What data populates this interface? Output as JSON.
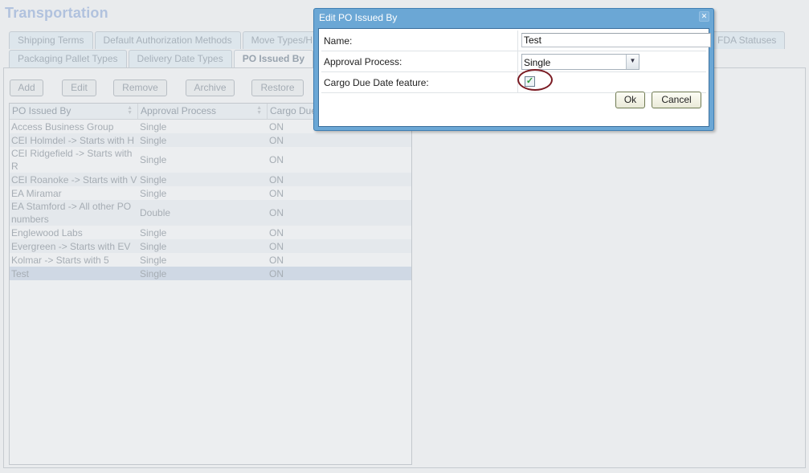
{
  "app": {
    "title": "Transportation"
  },
  "tabs": {
    "row1": [
      {
        "label": "Shipping Terms"
      },
      {
        "label": "Default Authorization Methods"
      },
      {
        "label": "Move Types/H"
      }
    ],
    "row1_right": {
      "label": "FDA Statuses"
    },
    "row2": [
      {
        "label": "Packaging Pallet Types"
      },
      {
        "label": "Delivery Date Types"
      },
      {
        "label": "PO Issued By",
        "active": true
      }
    ]
  },
  "toolbar": {
    "add_label": "Add",
    "edit_label": "Edit",
    "remove_label": "Remove",
    "archive_label": "Archive",
    "restore_label": "Restore"
  },
  "grid": {
    "columns": [
      "PO Issued By",
      "Approval Process",
      "Cargo Due"
    ],
    "rows": [
      {
        "name": "Access Business Group",
        "approval": "Single",
        "cargo": "ON"
      },
      {
        "name": "CEI Holmdel -> Starts with H",
        "approval": "Single",
        "cargo": "ON"
      },
      {
        "name": "CEI Ridgefield -> Starts with R",
        "approval": "Single",
        "cargo": "ON"
      },
      {
        "name": "CEI Roanoke -> Starts with V",
        "approval": "Single",
        "cargo": "ON"
      },
      {
        "name": "EA Miramar",
        "approval": "Single",
        "cargo": "ON"
      },
      {
        "name": "EA Stamford -> All other PO numbers",
        "approval": "Double",
        "cargo": "ON"
      },
      {
        "name": "Englewood Labs",
        "approval": "Single",
        "cargo": "ON"
      },
      {
        "name": "Evergreen -> Starts with EV",
        "approval": "Single",
        "cargo": "ON"
      },
      {
        "name": "Kolmar -> Starts with 5",
        "approval": "Single",
        "cargo": "ON"
      },
      {
        "name": "Test",
        "approval": "Single",
        "cargo": "ON",
        "selected": true
      }
    ]
  },
  "dialog": {
    "title": "Edit PO Issued By",
    "close_icon": "close-icon",
    "fields": {
      "name_label": "Name:",
      "name_value": "Test",
      "approval_label": "Approval Process:",
      "approval_value": "Single",
      "cargo_label": "Cargo Due Date feature:",
      "cargo_checked": true
    },
    "ok_label": "Ok",
    "cancel_label": "Cancel"
  }
}
